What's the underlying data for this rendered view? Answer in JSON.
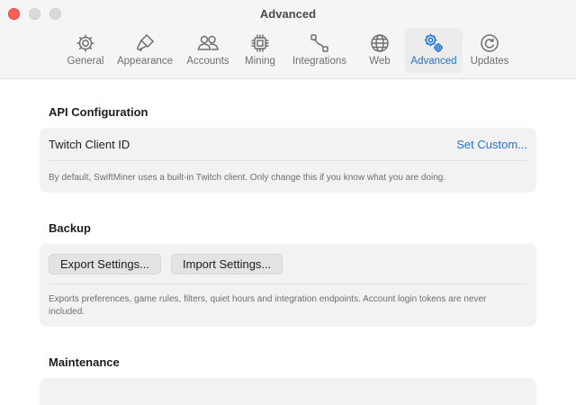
{
  "window": {
    "title": "Advanced"
  },
  "tabs": [
    {
      "label": "General",
      "icon": "gear-icon"
    },
    {
      "label": "Appearance",
      "icon": "paintbrush-icon"
    },
    {
      "label": "Accounts",
      "icon": "people-icon"
    },
    {
      "label": "Mining",
      "icon": "cpu-icon"
    },
    {
      "label": "Integrations",
      "icon": "connection-icon"
    },
    {
      "label": "Web",
      "icon": "globe-icon"
    },
    {
      "label": "Advanced",
      "icon": "gears-icon",
      "active": true
    },
    {
      "label": "Updates",
      "icon": "refresh-icon"
    }
  ],
  "accent_color": "#1f73d6",
  "api": {
    "title": "API Configuration",
    "client_id_label": "Twitch Client ID",
    "set_custom": "Set Custom...",
    "help": "By default, SwiftMiner uses a built-in Twitch client. Only change this if you know what you are doing."
  },
  "backup": {
    "title": "Backup",
    "export_label": "Export Settings...",
    "import_label": "Import Settings...",
    "help": "Exports preferences, game rules, filters, quiet hours and integration endpoints. Account login tokens are never included."
  },
  "maintenance": {
    "title": "Maintenance"
  }
}
